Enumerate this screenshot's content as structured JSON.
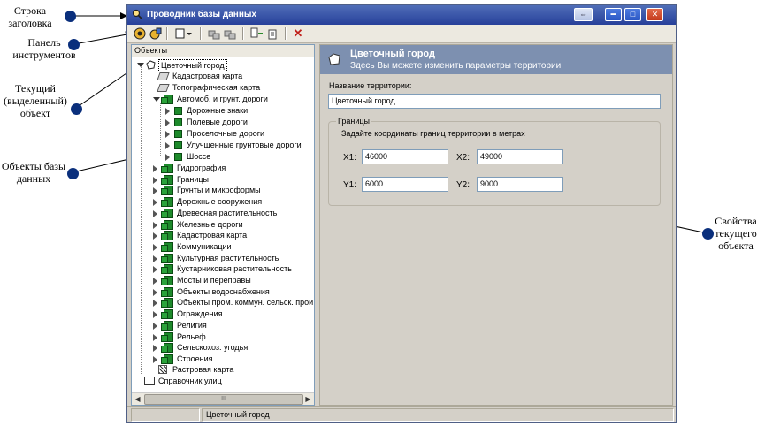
{
  "annotations": {
    "title_bar": "Строка\nзаголовка",
    "toolbar": "Панель\nинструментов",
    "current": "Текущий\n(выделенный)\nобъект",
    "db_objects": "Объекты базы\nданных",
    "props": "Свойства\nтекущего\nобъекта"
  },
  "window": {
    "title": "Проводник базы данных",
    "buttons": {
      "restore": "⇔",
      "minimize": "▬",
      "maximize": "□",
      "close": "✕"
    }
  },
  "toolbar": {
    "icons": [
      "open-db-icon",
      "db-icon",
      "new-dropdown-icon",
      "copy-icon",
      "paste-icon",
      "move-icon",
      "delete-list-icon",
      "delete-icon"
    ]
  },
  "tree": {
    "header": "Объекты",
    "root": "Цветочный город",
    "level1_static": [
      "Кадастровая карта",
      "Топографическая карта"
    ],
    "roads": "Автомоб. и грунт. дороги",
    "roads_children": [
      "Дорожные знаки",
      "Полевые дороги",
      "Проселочные дороги",
      "Улучшенные грунтовые дороги",
      "Шоссе"
    ],
    "groups": [
      "Гидрография",
      "Границы",
      "Грунты и микроформы",
      "Дорожные сооружения",
      "Древесная растительность",
      "Железные дороги",
      "Кадастровая карта",
      "Коммуникации",
      "Культурная растительность",
      "Кустарниковая растительность",
      "Мосты и переправы",
      "Объекты водоснабжения",
      "Объекты пром. коммун. сельск. прои",
      "Ограждения",
      "Религия",
      "Рельеф",
      "Сельскохоз. угодья",
      "Строения"
    ],
    "raster": "Растровая карта",
    "streets": "Справочник улиц",
    "scroll_thumb": "III"
  },
  "panel": {
    "title": "Цветочный город",
    "subtitle": "Здесь Вы можете изменить параметры территории",
    "name_label": "Название территории:",
    "name_value": "Цветочный город",
    "bounds_title": "Границы",
    "bounds_desc": "Задайте координаты границ территории в метрах",
    "x1_label": "X1:",
    "x1": "46000",
    "x2_label": "X2:",
    "x2": "49000",
    "y1_label": "Y1:",
    "y1": "6000",
    "y2_label": "Y2:",
    "y2": "9000"
  },
  "status": {
    "text": "Цветочный город"
  },
  "colors": {
    "dot": "#0a2f7c",
    "title_bar": "#27409a",
    "panel_header": "#7d90b0"
  }
}
